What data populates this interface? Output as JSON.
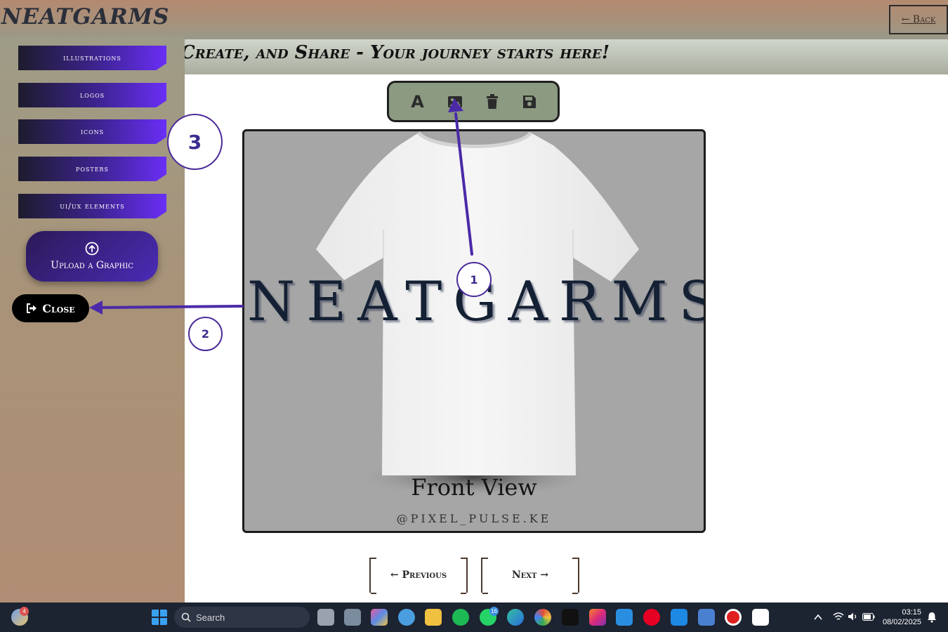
{
  "header": {
    "logo": "NEATGARMS",
    "back_label": "← Back",
    "banner": "Create, and Share - Your journey starts here!"
  },
  "sidebar": {
    "items": [
      {
        "label": "illustrations"
      },
      {
        "label": "logos"
      },
      {
        "label": "icons"
      },
      {
        "label": "posters"
      },
      {
        "label": "ui/ux elements"
      }
    ],
    "upload_label": "Upload a Graphic",
    "close_label": "Close"
  },
  "toolbar": {
    "tools": [
      "text-icon",
      "image-icon",
      "trash-icon",
      "save-icon"
    ],
    "text_tool_glyph": "A"
  },
  "canvas": {
    "brand_text": "NEATGARMS",
    "view_label": "Front View",
    "handle": "@PIXEL_PULSE.KE"
  },
  "pager": {
    "previous_label": "← Previous",
    "next_label": "Next →"
  },
  "annotations": {
    "one": "1",
    "two": "2",
    "three": "3",
    "color": "#4b2aa8"
  },
  "taskbar": {
    "search_placeholder": "Search",
    "weather_badge": "4",
    "whatsapp_badge": "16",
    "time": "03:15",
    "date": "08/02/2025"
  },
  "colors": {
    "accent": "#6a2ef6",
    "toolbar_bg": "#8c9a82",
    "canvas_bg": "#a6a6a6"
  }
}
